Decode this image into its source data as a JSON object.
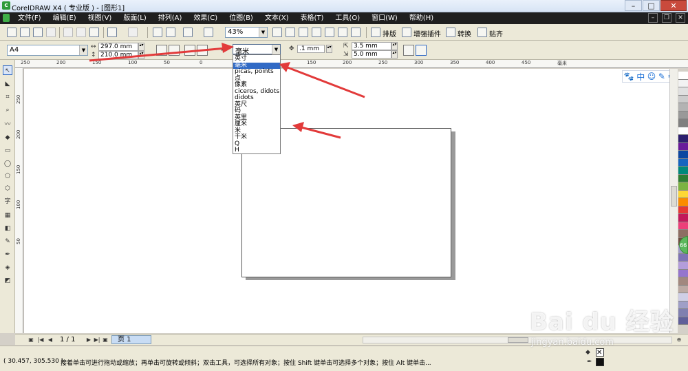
{
  "window": {
    "title": "CorelDRAW X4 ( 专业版 ) - [图形1]"
  },
  "menu": {
    "items": [
      "文件(F)",
      "编辑(E)",
      "视图(V)",
      "版面(L)",
      "排列(A)",
      "效果(C)",
      "位图(B)",
      "文本(X)",
      "表格(T)",
      "工具(O)",
      "窗口(W)",
      "帮助(H)"
    ]
  },
  "toolbar": {
    "zoom": "43%",
    "btn_layout": "排版",
    "btn_plugin": "增强插件",
    "btn_convert": "转换",
    "btn_snap": "贴齐"
  },
  "property_bar": {
    "paper_size": "A4",
    "width": "297.0 mm",
    "height": "210.0 mm",
    "units": "毫米",
    "nudge": ".1 mm",
    "dup_x": "3.5 mm",
    "dup_y": "5.0 mm"
  },
  "unit_options": [
    "英寸",
    "毫米",
    "picas, points",
    "点",
    "像素",
    "ciceros, didots",
    "didots",
    "英尺",
    "码",
    "英里",
    "厘米",
    "米",
    "千米",
    "Q",
    "H"
  ],
  "unit_selected_index": 1,
  "ruler": {
    "h_labels": [
      "250",
      "200",
      "150",
      "100",
      "50",
      "0",
      "50",
      "100",
      "150",
      "200",
      "250",
      "300",
      "350",
      "400",
      "450"
    ],
    "v_labels": [
      "250",
      "200",
      "150",
      "100",
      "50"
    ],
    "unit": "毫米"
  },
  "floating_toolbar": {
    "lang": "中"
  },
  "page_nav": {
    "count": "1 / 1",
    "tab": "页 1"
  },
  "status": {
    "coords": "( 30.457, 305.530 )",
    "message": "接着单击可进行拖动或缩放；再单击可旋转或倾斜；双击工具，可选择所有对象；按住 Shift 键单击可选择多个对象；按住 Alt 键单击..."
  },
  "side_badge": "66",
  "watermark": {
    "logo": "Bai du 经验",
    "sub": "jingyan.baidu.com"
  },
  "colors": {
    "menubar": "#1f1f1f",
    "selection": "#316ac5",
    "arrow": "#e23a3a",
    "palette": [
      "#ffffff",
      "#f2f2f2",
      "#e0e0e0",
      "#cccccc",
      "#b3b3b3",
      "#999999",
      "#808080",
      "#ffffff",
      "#2d1f6e",
      "#6a1b9a",
      "#0d47a1",
      "#1565c0",
      "#00897b",
      "#2e7d32",
      "#7cb342",
      "#fdd835",
      "#fb8c00",
      "#e53935",
      "#c2185b",
      "#ec407a",
      "#8d6e63",
      "#6d4c41",
      "#9e9ac8",
      "#7e73b5",
      "#b39ddb",
      "#9575cd",
      "#a1887f",
      "#bcaaa4",
      "#cfcfe6",
      "#9f9fc7",
      "#8080b0",
      "#60609a"
    ]
  }
}
